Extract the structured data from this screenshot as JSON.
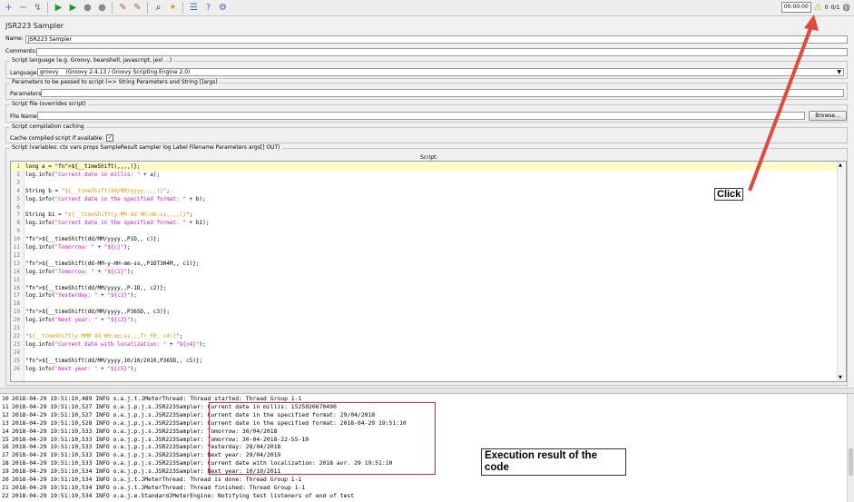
{
  "toolbar": {
    "timer": "00:00:00",
    "warnings": "0",
    "threads": "0/1"
  },
  "sampler": {
    "title": "JSR223 Sampler",
    "name_label": "Name:",
    "name_value": "JSR223 Sampler",
    "comments_label": "Comments:"
  },
  "script_language": {
    "legend": "Script language (e.g. Groovy, beanshell, javascript, jexl ...)",
    "label": "Language:",
    "value": "groovy",
    "engine": "(Groovy 2.4.13 / Groovy Scripting Engine 2.0)"
  },
  "parameters": {
    "legend": "Parameters to be passed to script (=> String Parameters and String []args)",
    "label": "Parameters:"
  },
  "script_file": {
    "legend": "Script file (overrides script)",
    "label": "File Name:",
    "browse": "Browse..."
  },
  "caching": {
    "legend": "Script compilation caching",
    "label": "Cache compiled script if available:",
    "checked": "✓"
  },
  "script": {
    "legend": "Script (variables: ctx vars props SampleResult sampler log Label Filename Parameters args[] OUT)",
    "header": "Script:",
    "lines": [
      "long a = ${__timeShift(,,,,)};",
      "log.info(\"Current date in millis: \" + a);",
      "",
      "String b = \"${__timeShift(dd/MM/yyyy,,,,)}\";",
      "log.info(\"Current date in the specified format: \" + b);",
      "",
      "String b1 = \"${__timeShift(y-MM-dd HH:mm:ss,,,,)}\";",
      "log.info(\"Current date in the specified format: \" + b1);",
      "",
      "${__timeShift(dd/MM/yyyy,,P1D,, c)};",
      "log.info(\"Tomorrow: \" + \"${c}\");",
      "",
      "${__timeShift(dd-MM-y-HH-mm-ss,,P1DT3H4M,, c1)};",
      "log.info(\"Tomorrow: \" + \"${c1}\");",
      "",
      "${__timeShift(dd/MM/yyyy,,P-1D,, c2)};",
      "log.info(\"Yesterday: \" + \"${c2}\");",
      "",
      "${__timeShift(dd/MM/yyyy,,P365D,, c3)};",
      "log.info(\"Next year: \" + \"${c3}\");",
      "",
      "\"${__timeShift(y MMM dd HH:mm:ss,,,fr_FR, c4)}\";",
      "log.info(\"Current date with localization: \" + \"${c4}\");",
      "",
      "${__timeShift(dd/MM/yyyy,10/10/2010,P365D,, c5)};",
      "log.info(\"Next year: \" + \"${c5}\");"
    ]
  },
  "log": {
    "lines": [
      [
        "10",
        "2018-04-29 19:51:10,489 INFO o.a.j.t.JMeterThread: ",
        "Thread started: Thread Group 1-1"
      ],
      [
        "11",
        "2018-04-29 19:51:10,527 INFO o.a.j.p.j.s.JSR223Sampler: ",
        "Current date in millis: 1525020670490"
      ],
      [
        "12",
        "2018-04-29 19:51:10,527 INFO o.a.j.p.j.s.JSR223Sampler: ",
        "Current date in the specified format: 29/04/2018"
      ],
      [
        "13",
        "2018-04-29 19:51:10,528 INFO o.a.j.p.j.s.JSR223Sampler: ",
        "Current date in the specified format: 2018-04-29 19:51:10"
      ],
      [
        "14",
        "2018-04-29 19:51:10,533 INFO o.a.j.p.j.s.JSR223Sampler: ",
        "Tomorrow: 30/04/2018"
      ],
      [
        "15",
        "2018-04-29 19:51:10,533 INFO o.a.j.p.j.s.JSR223Sampler: ",
        "Tomorrow: 30-04-2018-22-55-10"
      ],
      [
        "16",
        "2018-04-29 19:51:10,533 INFO o.a.j.p.j.s.JSR223Sampler: ",
        "Yesterday: 28/04/2018"
      ],
      [
        "17",
        "2018-04-29 19:51:10,533 INFO o.a.j.p.j.s.JSR223Sampler: ",
        "Next year: 29/04/2019"
      ],
      [
        "18",
        "2018-04-29 19:51:10,533 INFO o.a.j.p.j.s.JSR223Sampler: ",
        "Current date with localization: 2018 avr. 29 19:51:10"
      ],
      [
        "19",
        "2018-04-29 19:51:10,534 INFO o.a.j.p.j.s.JSR223Sampler: ",
        "Next year: 10/10/2011"
      ],
      [
        "20",
        "2018-04-29 19:51:10,534 INFO o.a.j.t.JMeterThread: ",
        "Thread is done: Thread Group 1-1"
      ],
      [
        "21",
        "2018-04-29 19:51:10,534 INFO o.a.j.t.JMeterThread: ",
        "Thread finished: Thread Group 1-1"
      ],
      [
        "22",
        "2018-04-29 19:51:10,534 INFO o.a.j.e.StandardJMeterEngine: ",
        "Notifying test listeners of end of test"
      ]
    ]
  },
  "annotations": {
    "click": "Click",
    "execution": "Execution result of the code"
  },
  "colors": {
    "highlight_box": "#e02a2a",
    "arrow": "#e04a3f",
    "string": "#d30fcf",
    "function": "#e39a00"
  }
}
